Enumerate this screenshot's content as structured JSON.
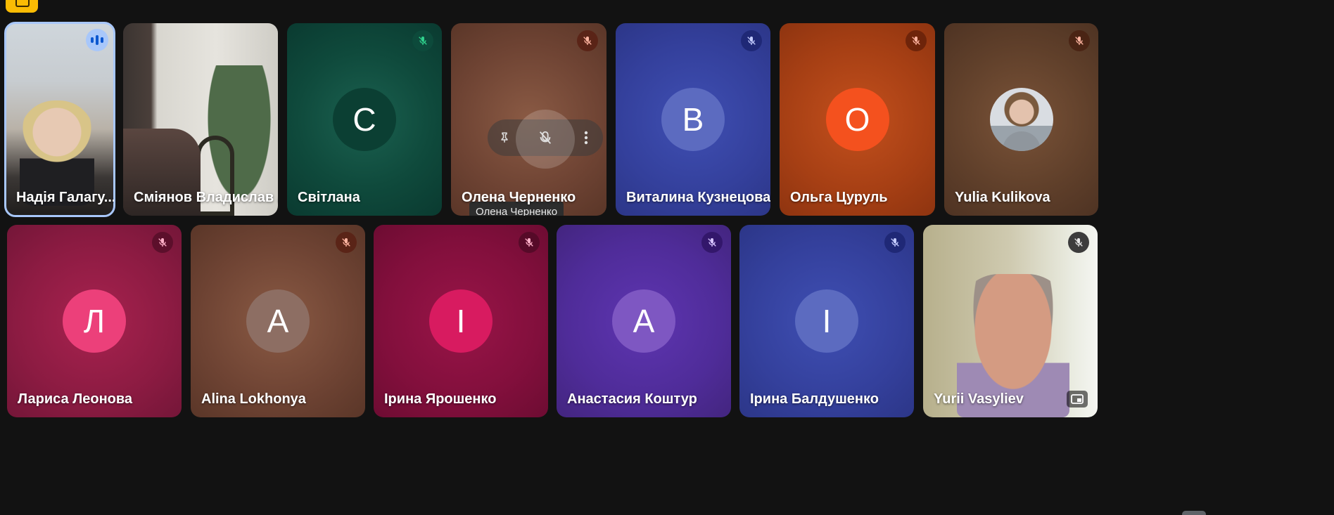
{
  "colors": {
    "speaking_outline": "#a8c7fa",
    "badge": "#fbbc04"
  },
  "participants_row1": [
    {
      "name": "Надія Галагу...",
      "type": "video",
      "speaking": true
    },
    {
      "name": "Сміянов Владислав А...",
      "type": "video"
    },
    {
      "name": "Світлана",
      "initial": "С",
      "muted": true
    },
    {
      "name": "Олена Черненко",
      "muted": true,
      "hovered": true
    },
    {
      "name": "Виталина Кузнецова",
      "initial": "В",
      "muted": true
    },
    {
      "name": "Ольга Цуруль",
      "initial": "О",
      "muted": true
    },
    {
      "name": "Yulia Kulikova",
      "type": "photo-avatar",
      "muted": true
    }
  ],
  "participants_row2": [
    {
      "name": "Лариса Леонова",
      "initial": "Л",
      "muted": true
    },
    {
      "name": "Alina Lokhonya",
      "initial": "А",
      "muted": true
    },
    {
      "name": "Ірина Ярошенко",
      "initial": "І",
      "muted": true
    },
    {
      "name": "Анастасия Коштур",
      "initial": "А",
      "muted": true
    },
    {
      "name": "Ірина Балдушенко",
      "initial": "І",
      "muted": true
    },
    {
      "name": "Yurii Vasyliev",
      "type": "video",
      "muted": true
    }
  ],
  "tooltip": {
    "text": "Олена Черненко"
  },
  "icons": {
    "mute": "mic-off-icon",
    "pin": "pin-icon",
    "mute_btn": "mic-off-icon",
    "more": "more-vert-icon",
    "pip": "picture-in-picture-icon",
    "speaking": "audio-level-icon"
  }
}
